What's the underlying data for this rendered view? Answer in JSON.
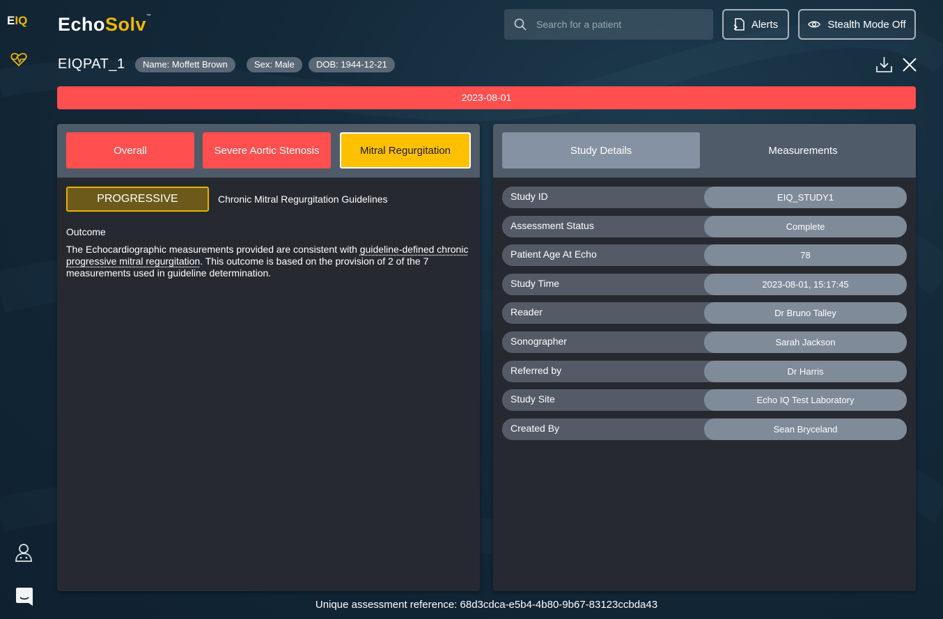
{
  "sidebar": {
    "logo_e": "E",
    "logo_iq": "IQ",
    "icons": [
      "heart-pulse-icon",
      "user-icon",
      "chat-icon"
    ]
  },
  "header": {
    "brand_echo": "Echo",
    "brand_solv": "Solv",
    "brand_tm": "™",
    "search_placeholder": "Search for a patient",
    "alerts_label": "Alerts",
    "stealth_label": "Stealth Mode Off"
  },
  "patient": {
    "id": "EIQPAT_1",
    "name_chip": "Name: Moffett Brown",
    "sex_chip": "Sex: Male",
    "dob_chip": "DOB: 1944-12-21"
  },
  "date_bar": "2023-08-01",
  "colors": {
    "severe": "#ff4f4f",
    "moderate": "#ffc000",
    "panel": "#262a30"
  },
  "conditions": {
    "overall": "Overall",
    "aortic_stenosis": "Severe Aortic Stenosis",
    "mitral_regurgitation": "Mitral Regurgitation"
  },
  "assessment": {
    "stage": "PROGRESSIVE",
    "guideline_title": "Chronic Mitral Regurgitation Guidelines",
    "outcome_label": "Outcome",
    "outcome_part1": "The Echocardiographic measurements provided are consistent with ",
    "outcome_link": "guideline-defined chronic progressive mitral regurgitation",
    "outcome_part2": ". This outcome is based on the provision of 2 of the 7 measurements used in guideline determination."
  },
  "right_tabs": {
    "details": "Study Details",
    "measurements": "Measurements"
  },
  "study_details": [
    {
      "label": "Study ID",
      "value": "EIQ_STUDY1"
    },
    {
      "label": "Assessment Status",
      "value": "Complete"
    },
    {
      "label": "Patient Age At Echo",
      "value": "78"
    },
    {
      "label": "Study Time",
      "value": "2023-08-01, 15:17:45"
    },
    {
      "label": "Reader",
      "value": "Dr Bruno Talley"
    },
    {
      "label": "Sonographer",
      "value": "Sarah Jackson"
    },
    {
      "label": "Referred by",
      "value": "Dr Harris"
    },
    {
      "label": "Study Site",
      "value": "Echo IQ Test Laboratory"
    },
    {
      "label": "Created By",
      "value": "Sean Bryceland"
    }
  ],
  "footer": {
    "reference": "Unique assessment reference: 68d3cdca-e5b4-4b80-9b67-83123ccbda43"
  }
}
